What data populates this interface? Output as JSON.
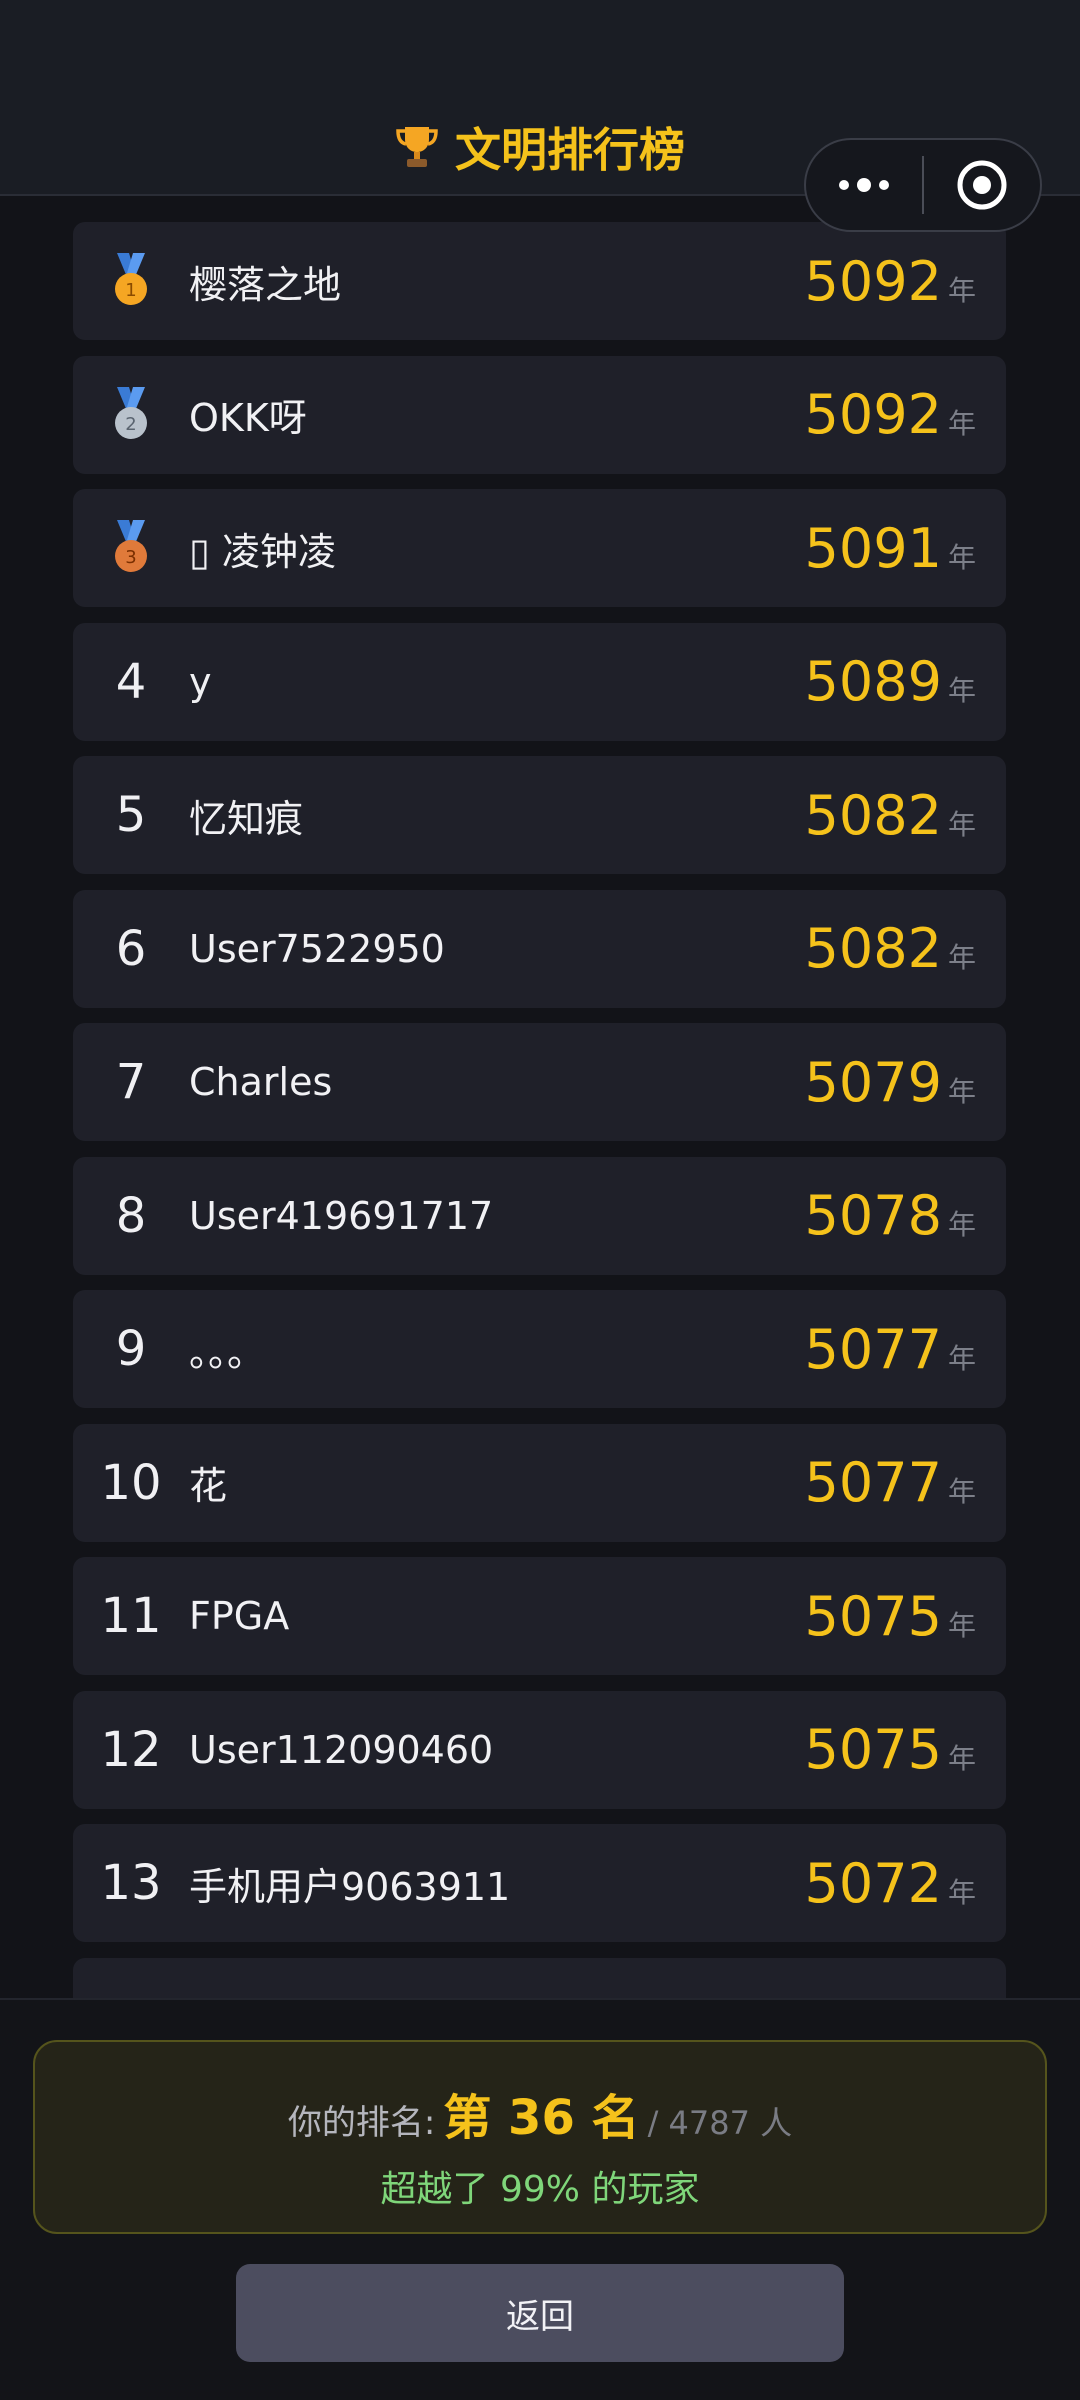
{
  "header": {
    "title": "文明排行榜",
    "title_icon": "trophy-icon"
  },
  "capsule": {
    "more_icon": "more-dots-icon",
    "close_icon": "target-close-icon"
  },
  "list": {
    "unit": "年",
    "rows": [
      {
        "rank": "1",
        "medal": "gold",
        "name": "樱落之地",
        "score": "5092"
      },
      {
        "rank": "2",
        "medal": "silver",
        "name": "OKK呀",
        "score": "5092"
      },
      {
        "rank": "3",
        "medal": "bronze",
        "name": "▯  凌钟凌",
        "score": "5091"
      },
      {
        "rank": "4",
        "name": "y",
        "score": "5089"
      },
      {
        "rank": "5",
        "name": "忆知痕",
        "score": "5082"
      },
      {
        "rank": "6",
        "name": "User7522950",
        "score": "5082"
      },
      {
        "rank": "7",
        "name": "Charles",
        "score": "5079"
      },
      {
        "rank": "8",
        "name": "User419691717",
        "score": "5078"
      },
      {
        "rank": "9",
        "name": "。。。",
        "score": "5077"
      },
      {
        "rank": "10",
        "name": "花",
        "score": "5077"
      },
      {
        "rank": "11",
        "name": "FPGA",
        "score": "5075"
      },
      {
        "rank": "12",
        "name": "User112090460",
        "score": "5075"
      },
      {
        "rank": "13",
        "name": "手机用户9063911",
        "score": "5072"
      }
    ]
  },
  "my_rank": {
    "label": "你的排名:",
    "value": "第 36 名",
    "total": "/ 4787 人",
    "beat": "超越了 99% 的玩家"
  },
  "back_button": {
    "label": "返回"
  },
  "colors": {
    "accent": "#f5c21b",
    "beat_text": "#7fd67a",
    "row_bg": "#1f2029",
    "page_bg": "#121318"
  }
}
